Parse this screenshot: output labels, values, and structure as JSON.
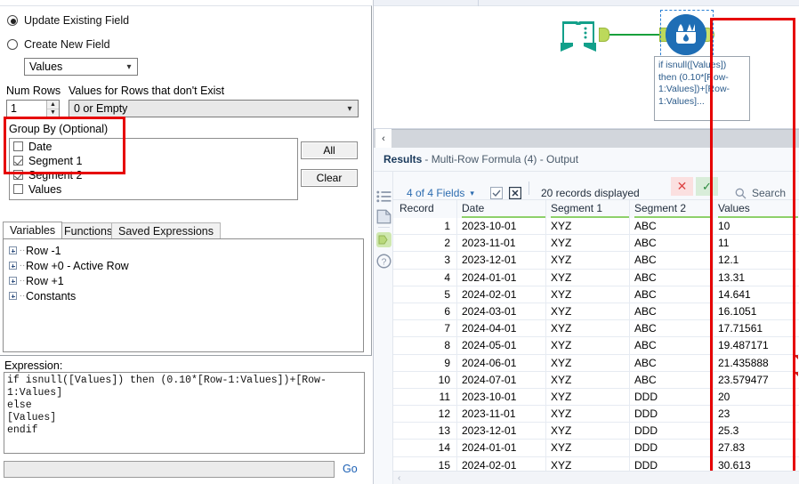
{
  "config": {
    "radio_update": "Update Existing Field",
    "radio_create": "Create New  Field",
    "radio_selected": "update",
    "field_combo_value": "Values",
    "num_rows_label": "Num Rows",
    "num_rows_value": "1",
    "no_values_label": "Values for Rows that don't Exist",
    "no_values_value": "0 or Empty",
    "groupby_label": "Group By (Optional)",
    "groupby_items": [
      {
        "label": "Date",
        "checked": false
      },
      {
        "label": "Segment 1",
        "checked": true
      },
      {
        "label": "Segment 2",
        "checked": true
      },
      {
        "label": "Values",
        "checked": false
      }
    ],
    "btn_all": "All",
    "btn_clear": "Clear",
    "highlight_color": "#e60000"
  },
  "tabs": [
    {
      "label": "Variables",
      "active": true
    },
    {
      "label": "Functions",
      "active": false
    },
    {
      "label": "Saved Expressions",
      "active": false
    }
  ],
  "tree": [
    {
      "label": "Row -1"
    },
    {
      "label": "Row +0 - Active Row"
    },
    {
      "label": "Row +1"
    },
    {
      "label": "Constants"
    }
  ],
  "expression": {
    "label": "Expression:",
    "text": "if isnull([Values]) then (0.10*[Row-1:Values])+[Row-\n1:Values]\nelse\n[Values]\nendif",
    "search_value": "",
    "go_label": "Go"
  },
  "canvas": {
    "node_input_name": "input-data-book-icon",
    "node_formula_name": "multi-row-formula-icon",
    "annotation": "if isnull([Values]) then (0.10*[Row-1:Values])+[Row-1:Values]..."
  },
  "results": {
    "collapse_icon": "‹",
    "title_bold": "Results",
    "title_rest": "- Multi-Row Formula (4) - Output",
    "fields_label": "4 of 4 Fields",
    "chevron": "⌄",
    "records_label": "20 records displayed",
    "x_icon": "✕",
    "check_icon": "✓",
    "search_label": "Search",
    "search_icon": "⚲",
    "sidebar_icons": [
      "list-icon",
      "page-icon",
      "output-anchor-icon",
      "help-icon"
    ],
    "help_icon": "?",
    "scroll_icon": "‹"
  },
  "grid": {
    "columns": [
      "Record",
      "Date",
      "Segment 1",
      "Segment 2",
      "Values"
    ],
    "rows": [
      {
        "record": "1",
        "date": "2023-10-01",
        "seg1": "XYZ",
        "seg2": "ABC",
        "value": "10",
        "flag": false
      },
      {
        "record": "2",
        "date": "2023-11-01",
        "seg1": "XYZ",
        "seg2": "ABC",
        "value": "11",
        "flag": false
      },
      {
        "record": "3",
        "date": "2023-12-01",
        "seg1": "XYZ",
        "seg2": "ABC",
        "value": "12.1",
        "flag": false
      },
      {
        "record": "4",
        "date": "2024-01-01",
        "seg1": "XYZ",
        "seg2": "ABC",
        "value": "13.31",
        "flag": false
      },
      {
        "record": "5",
        "date": "2024-02-01",
        "seg1": "XYZ",
        "seg2": "ABC",
        "value": "14.641",
        "flag": false
      },
      {
        "record": "6",
        "date": "2024-03-01",
        "seg1": "XYZ",
        "seg2": "ABC",
        "value": "16.1051",
        "flag": false
      },
      {
        "record": "7",
        "date": "2024-04-01",
        "seg1": "XYZ",
        "seg2": "ABC",
        "value": "17.71561",
        "flag": false
      },
      {
        "record": "8",
        "date": "2024-05-01",
        "seg1": "XYZ",
        "seg2": "ABC",
        "value": "19.487171",
        "flag": false
      },
      {
        "record": "9",
        "date": "2024-06-01",
        "seg1": "XYZ",
        "seg2": "ABC",
        "value": "21.435888",
        "flag": true
      },
      {
        "record": "10",
        "date": "2024-07-01",
        "seg1": "XYZ",
        "seg2": "ABC",
        "value": "23.579477",
        "flag": true
      },
      {
        "record": "11",
        "date": "2023-10-01",
        "seg1": "XYZ",
        "seg2": "DDD",
        "value": "20",
        "flag": false
      },
      {
        "record": "12",
        "date": "2023-11-01",
        "seg1": "XYZ",
        "seg2": "DDD",
        "value": "23",
        "flag": false
      },
      {
        "record": "13",
        "date": "2023-12-01",
        "seg1": "XYZ",
        "seg2": "DDD",
        "value": "25.3",
        "flag": false
      },
      {
        "record": "14",
        "date": "2024-01-01",
        "seg1": "XYZ",
        "seg2": "DDD",
        "value": "27.83",
        "flag": false
      },
      {
        "record": "15",
        "date": "2024-02-01",
        "seg1": "XYZ",
        "seg2": "DDD",
        "value": "30.613",
        "flag": false
      }
    ]
  }
}
